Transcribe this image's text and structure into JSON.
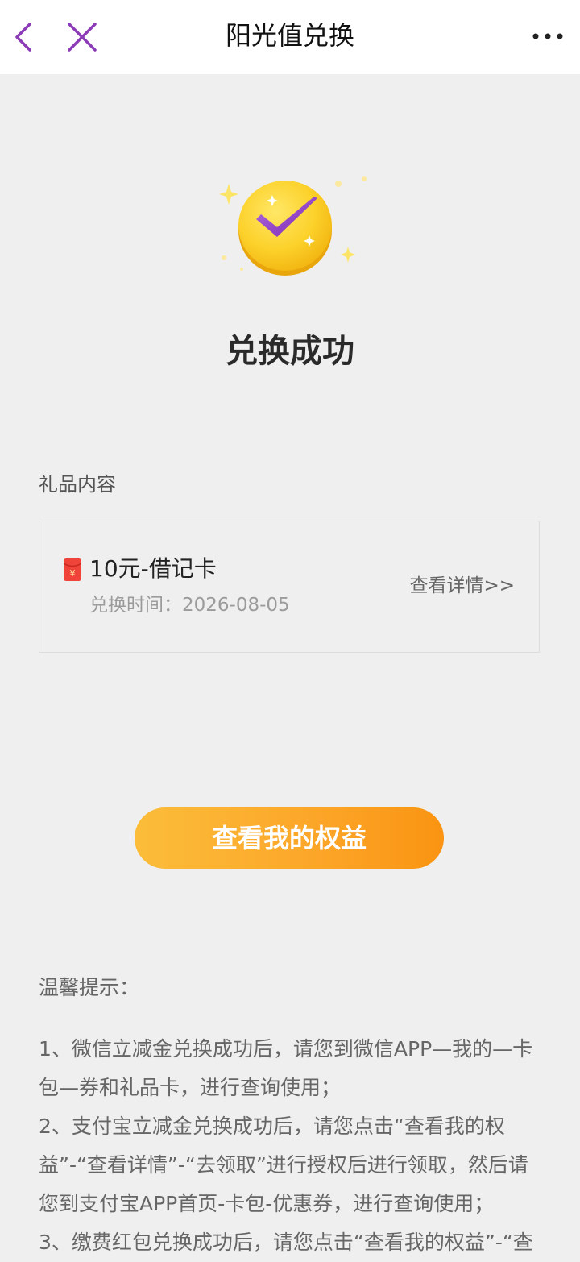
{
  "nav": {
    "title": "阳光值兑换",
    "back_icon": "chevron-left-icon",
    "close_icon": "close-icon",
    "more_icon": "more-dots-icon",
    "accent_color": "#8a3bb5"
  },
  "result": {
    "status_text": "兑换成功",
    "badge_icon": "check-coin-icon"
  },
  "gift": {
    "section_label": "礼品内容",
    "icon": "red-envelope-icon",
    "name": "10元-借记卡",
    "time": "兑换时间：2026-08-05",
    "detail_link": "查看详情>>"
  },
  "cta": {
    "label": "查看我的权益",
    "colors": [
      "#fbbd3a",
      "#fa9412"
    ]
  },
  "tips": {
    "title": "温馨提示：",
    "items": [
      "1、微信立减金兑换成功后，请您到微信APP—我的—卡包—券和礼品卡，进行查询使用；",
      "2、支付宝立减金兑换成功后，请您点击“查看我的权益”-“查看详情”-“去领取”进行授权后进行领取，然后请您到支付宝APP首页-卡包-优惠券，进行查询使用；",
      "3、缴费红包兑换成功后，请您点击“查看我的权益”-“查"
    ]
  }
}
